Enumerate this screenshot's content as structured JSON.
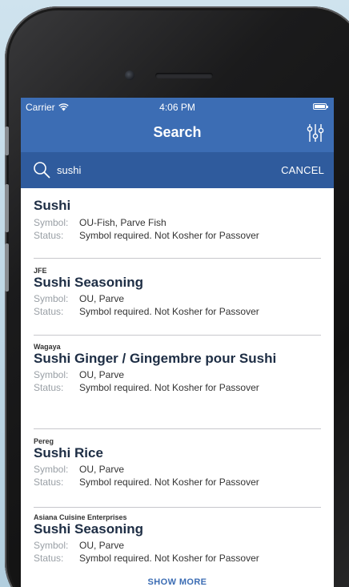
{
  "status_bar": {
    "carrier": "Carrier",
    "time": "4:06 PM"
  },
  "nav": {
    "title": "Search"
  },
  "search": {
    "query": "sushi",
    "cancel_label": "CANCEL"
  },
  "labels": {
    "symbol": "Symbol:",
    "status": "Status:"
  },
  "results": [
    {
      "brand": "",
      "name": "Sushi",
      "symbol": "OU-Fish, Parve Fish",
      "status": "Symbol required. Not Kosher for Passover"
    },
    {
      "brand": "JFE",
      "name": "Sushi Seasoning",
      "symbol": "OU, Parve",
      "status": "Symbol required. Not Kosher for Passover"
    },
    {
      "brand": "Wagaya",
      "name": "Sushi Ginger / Gingembre pour Sushi",
      "symbol": "OU, Parve",
      "status": "Symbol required. Not Kosher for Passover"
    },
    {
      "brand": "Pereg",
      "name": "Sushi Rice",
      "symbol": "OU, Parve",
      "status": "Symbol required. Not Kosher for Passover"
    },
    {
      "brand": "Asiana Cuisine Enterprises",
      "name": "Sushi Seasoning",
      "symbol": "OU, Parve",
      "status": "Symbol required. Not Kosher for Passover"
    }
  ],
  "show_more_label": "SHOW MORE",
  "colors": {
    "header": "#3c6db4",
    "search_bar": "#2f5b9d"
  }
}
